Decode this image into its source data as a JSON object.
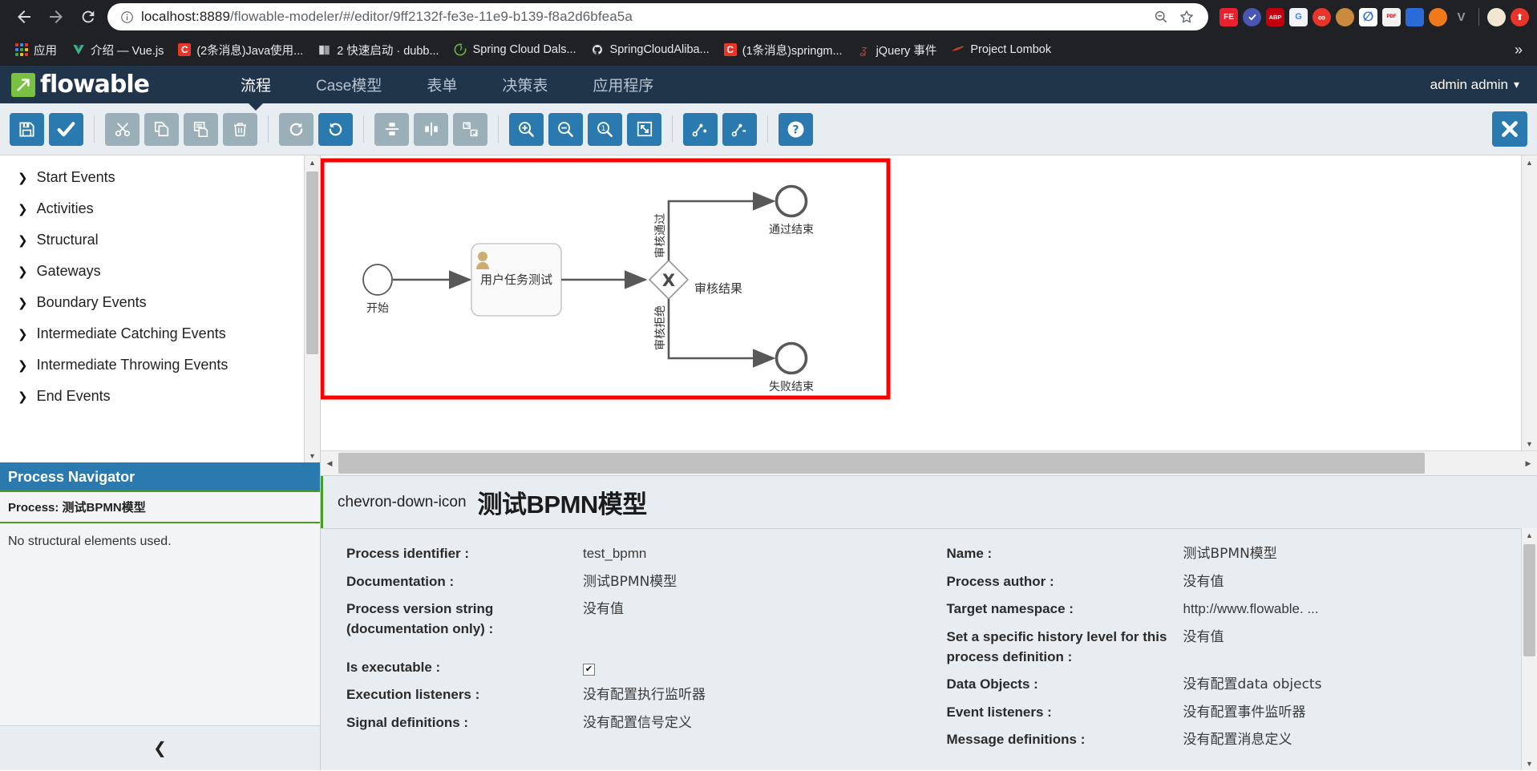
{
  "browser": {
    "back_icon": "back-arrow",
    "forward_icon": "forward-arrow",
    "reload_icon": "reload",
    "url_display": "localhost:8889",
    "url_path": "/flowable-modeler/#/editor/9ff2132f-fe3e-11e9-b139-f8a2d6bfea5a",
    "url_full": "localhost:8889/flowable-modeler/#/editor/9ff2132f-fe3e-11e9-b139-f8a2d6bfea5a",
    "omnibox_zoom_icon": "zoom-out-icon",
    "omnibox_star_icon": "bookmark-star-icon",
    "extensions": [
      {
        "name": "fe-extension",
        "label": "FE",
        "color": "#e8212e"
      },
      {
        "name": "check-circle-extension",
        "label": "",
        "color": "#4a56b3"
      },
      {
        "name": "adblock-plus-extension",
        "label": "ABP",
        "color": "#c4000f"
      },
      {
        "name": "google-translate-extension",
        "label": "G",
        "color": "#f1f3f4"
      },
      {
        "name": "infinity-extension",
        "label": "",
        "color": "#e8352a"
      },
      {
        "name": "monkey-extension",
        "label": "",
        "color": "#b9721c"
      },
      {
        "name": "pen-extension",
        "label": "",
        "color": "#ffffff"
      },
      {
        "name": "pdf-extension",
        "label": "PDF",
        "color": "#f2f2f2"
      },
      {
        "name": "window-extension",
        "label": "",
        "color": "#2a6bd8"
      },
      {
        "name": "orange-dot-extension",
        "label": "",
        "color": "#f07a1b"
      },
      {
        "name": "v-extension",
        "label": "V",
        "color": "#8f9aa5"
      },
      {
        "name": "profile-avatar",
        "label": "",
        "color": "#f0e6d2"
      },
      {
        "name": "update-extension",
        "label": "",
        "color": "#e8352a"
      }
    ],
    "bookmarks": [
      {
        "label": "应用",
        "icon": "apps-grid-icon"
      },
      {
        "label": "介绍 — Vue.js",
        "icon": "vue-icon"
      },
      {
        "label": "(2条消息)Java使用...",
        "icon": "csdn-icon"
      },
      {
        "label": "2 快速启动 · dubb...",
        "icon": "book-icon"
      },
      {
        "label": "Spring Cloud Dals...",
        "icon": "spring-icon"
      },
      {
        "label": "SpringCloudAliba...",
        "icon": "github-icon"
      },
      {
        "label": "(1条消息)springm...",
        "icon": "csdn-icon"
      },
      {
        "label": "jQuery 事件",
        "icon": "jquery-icon"
      },
      {
        "label": "Project Lombok",
        "icon": "lombok-icon"
      }
    ],
    "overflow_label": "»"
  },
  "app_header": {
    "logo_text": "flowable",
    "logo_icon": "flowable-arrow-icon",
    "nav": [
      {
        "label": "流程",
        "active": true,
        "name": "tab-process"
      },
      {
        "label": "Case模型",
        "active": false,
        "name": "tab-case-model"
      },
      {
        "label": "表单",
        "active": false,
        "name": "tab-forms"
      },
      {
        "label": "决策表",
        "active": false,
        "name": "tab-decision-tables"
      },
      {
        "label": "应用程序",
        "active": false,
        "name": "tab-apps"
      }
    ],
    "user_label": "admin admin",
    "user_caret": "▾"
  },
  "toolbar": {
    "buttons": [
      {
        "name": "save-button",
        "icon": "save-icon",
        "style": "blue"
      },
      {
        "name": "validate-button",
        "icon": "check-icon",
        "style": "blue"
      },
      {
        "name": "separator-1",
        "icon": "separator",
        "style": "sep"
      },
      {
        "name": "cut-button",
        "icon": "scissors-icon",
        "style": "grey"
      },
      {
        "name": "copy-button",
        "icon": "copy-icon",
        "style": "grey"
      },
      {
        "name": "paste-button",
        "icon": "paste-icon",
        "style": "grey"
      },
      {
        "name": "delete-button",
        "icon": "trash-icon",
        "style": "grey"
      },
      {
        "name": "separator-2",
        "icon": "separator",
        "style": "sep"
      },
      {
        "name": "redo-button",
        "icon": "redo-icon",
        "style": "grey"
      },
      {
        "name": "undo-button",
        "icon": "undo-icon",
        "style": "blue"
      },
      {
        "name": "separator-3",
        "icon": "separator",
        "style": "sep"
      },
      {
        "name": "align-vertical-button",
        "icon": "align-vertical-icon",
        "style": "grey"
      },
      {
        "name": "align-horizontal-button",
        "icon": "align-horizontal-icon",
        "style": "grey"
      },
      {
        "name": "same-size-button",
        "icon": "same-size-icon",
        "style": "grey"
      },
      {
        "name": "separator-4",
        "icon": "separator",
        "style": "sep"
      },
      {
        "name": "zoom-in-button",
        "icon": "zoom-in-icon",
        "style": "blue"
      },
      {
        "name": "zoom-out-button",
        "icon": "zoom-out-icon",
        "style": "blue"
      },
      {
        "name": "zoom-actual-button",
        "icon": "zoom-actual-icon",
        "style": "blue"
      },
      {
        "name": "zoom-fit-button",
        "icon": "zoom-fit-icon",
        "style": "blue"
      },
      {
        "name": "separator-5",
        "icon": "separator",
        "style": "sep"
      },
      {
        "name": "add-bendpoint-button",
        "icon": "add-bendpoint-icon",
        "style": "blue"
      },
      {
        "name": "remove-bendpoint-button",
        "icon": "remove-bendpoint-icon",
        "style": "blue"
      },
      {
        "name": "separator-6",
        "icon": "separator",
        "style": "sep"
      },
      {
        "name": "help-button",
        "icon": "help-icon",
        "style": "blue"
      }
    ],
    "close_icon": "close-x-icon"
  },
  "palette": {
    "groups": [
      {
        "label": "Start Events",
        "name": "palette-group-start-events"
      },
      {
        "label": "Activities",
        "name": "palette-group-activities"
      },
      {
        "label": "Structural",
        "name": "palette-group-structural"
      },
      {
        "label": "Gateways",
        "name": "palette-group-gateways"
      },
      {
        "label": "Boundary Events",
        "name": "palette-group-boundary-events"
      },
      {
        "label": "Intermediate Catching Events",
        "name": "palette-group-intermediate-catching-events"
      },
      {
        "label": "Intermediate Throwing Events",
        "name": "palette-group-intermediate-throwing-events"
      },
      {
        "label": "End Events",
        "name": "palette-group-end-events"
      }
    ]
  },
  "navigator": {
    "title": "Process Navigator",
    "process_line": "Process: 测试BPMN模型",
    "empty_text": "No structural elements used.",
    "collapse_icon": "chevron-left-icon"
  },
  "diagram": {
    "selection_color": "#ff0000",
    "nodes": [
      {
        "name": "start-event",
        "type": "start-event",
        "label": "开始"
      },
      {
        "name": "user-task",
        "type": "user-task",
        "label": "用户任务测试",
        "icon": "user-icon"
      },
      {
        "name": "exclusive-gateway",
        "type": "exclusive-gateway",
        "label": "审核结果",
        "marker": "X"
      },
      {
        "name": "end-event-pass",
        "type": "end-event",
        "label": "通过结束"
      },
      {
        "name": "end-event-fail",
        "type": "end-event",
        "label": "失败结束"
      }
    ],
    "flows": [
      {
        "name": "flow-start-to-task",
        "label": ""
      },
      {
        "name": "flow-task-to-gateway",
        "label": ""
      },
      {
        "name": "flow-gateway-pass",
        "label": "审核通过"
      },
      {
        "name": "flow-gateway-reject",
        "label": "审核拒绝"
      }
    ]
  },
  "properties": {
    "title": "测试BPMN模型",
    "collapse_icon": "chevron-down-icon",
    "left": [
      {
        "label": "Process identifier :",
        "value": "test_bpmn",
        "type": "text",
        "name": "prop-process-identifier"
      },
      {
        "label": "Documentation :",
        "value": "测试BPMN模型",
        "type": "text",
        "name": "prop-documentation"
      },
      {
        "label": "Process version string (documentation only) :",
        "value": "没有值",
        "type": "text",
        "name": "prop-process-version-string"
      },
      {
        "label": "Is executable :",
        "value": "✔",
        "type": "checkbox",
        "name": "prop-is-executable"
      },
      {
        "label": "Execution listeners :",
        "value": "没有配置执行监听器",
        "type": "text",
        "name": "prop-execution-listeners"
      },
      {
        "label": "Signal definitions :",
        "value": "没有配置信号定义",
        "type": "text",
        "name": "prop-signal-definitions"
      }
    ],
    "right": [
      {
        "label": "Name :",
        "value": "测试BPMN模型",
        "type": "text",
        "name": "prop-name"
      },
      {
        "label": "Process author :",
        "value": "没有值",
        "type": "text",
        "name": "prop-process-author"
      },
      {
        "label": "Target namespace :",
        "value": "http://www.flowable. ...",
        "type": "text",
        "name": "prop-target-namespace"
      },
      {
        "label": "Set a specific history level for this process definition :",
        "value": "没有值",
        "type": "text",
        "name": "prop-history-level"
      },
      {
        "label": "Data Objects :",
        "value": "没有配置data objects",
        "type": "text",
        "name": "prop-data-objects"
      },
      {
        "label": "Event listeners :",
        "value": "没有配置事件监听器",
        "type": "text",
        "name": "prop-event-listeners"
      },
      {
        "label": "Message definitions :",
        "value": "没有配置消息定义",
        "type": "text",
        "name": "prop-message-definitions"
      }
    ]
  }
}
